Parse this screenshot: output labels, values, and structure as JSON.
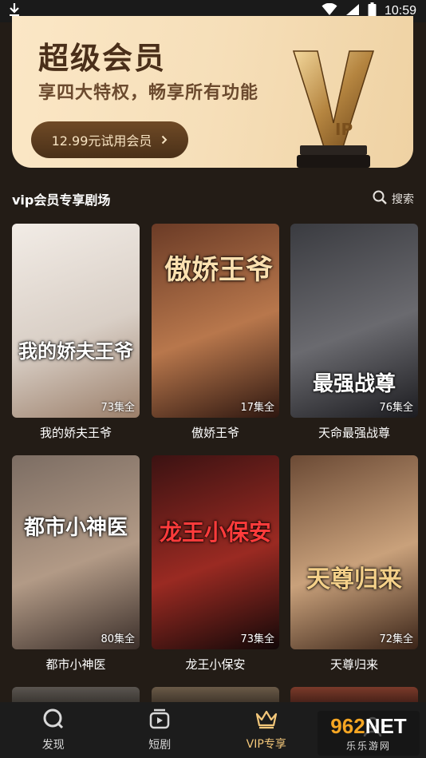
{
  "status_bar": {
    "time": "10:59"
  },
  "banner": {
    "title": "超级会员",
    "subtitle": "享四大特权，畅享所有功能",
    "trial_button": "12.99元试用会员"
  },
  "section": {
    "title": "vip会员专享剧场",
    "search_label": "搜索"
  },
  "dramas": [
    {
      "title": "我的娇夫王爷",
      "poster_text": "我的娇夫王爷",
      "episodes": "73集全",
      "colors": [
        "#f2ece6",
        "#d9cfc6",
        "#9b7f6a"
      ]
    },
    {
      "title": "傲娇王爷",
      "poster_text": "傲娇王爷",
      "episodes": "17集全",
      "colors": [
        "#6b3b26",
        "#b8774c",
        "#2e1710"
      ]
    },
    {
      "title": "天命最强战尊",
      "poster_text": "最强战尊",
      "episodes": "76集全",
      "colors": [
        "#3a3b40",
        "#6a6a6f",
        "#1c1c20"
      ]
    },
    {
      "title": "都市小神医",
      "poster_text": "都市小神医",
      "episodes": "80集全",
      "colors": [
        "#7c6d63",
        "#b29a86",
        "#3b2f2a"
      ]
    },
    {
      "title": "龙王小保安",
      "poster_text": "龙王小保安",
      "episodes": "73集全",
      "colors": [
        "#3b1212",
        "#9a2a22",
        "#120808"
      ]
    },
    {
      "title": "天尊归来",
      "poster_text": "天尊归来",
      "episodes": "72集全",
      "colors": [
        "#6b4a35",
        "#c9a17b",
        "#3a2418"
      ]
    }
  ],
  "tabs": [
    {
      "label": "发现",
      "icon": "discover-icon",
      "active": false
    },
    {
      "label": "短剧",
      "icon": "short-drama-icon",
      "active": false
    },
    {
      "label": "VIP专享",
      "icon": "crown-icon",
      "active": true
    },
    {
      "label": "",
      "icon": "profile-icon",
      "active": false
    }
  ],
  "watermark": {
    "number": "962",
    "net": "NET",
    "sub": "乐乐游网"
  },
  "colors": {
    "accent": "#f3c77a",
    "background": "#231c16",
    "banner_text": "#4a2f1a"
  }
}
